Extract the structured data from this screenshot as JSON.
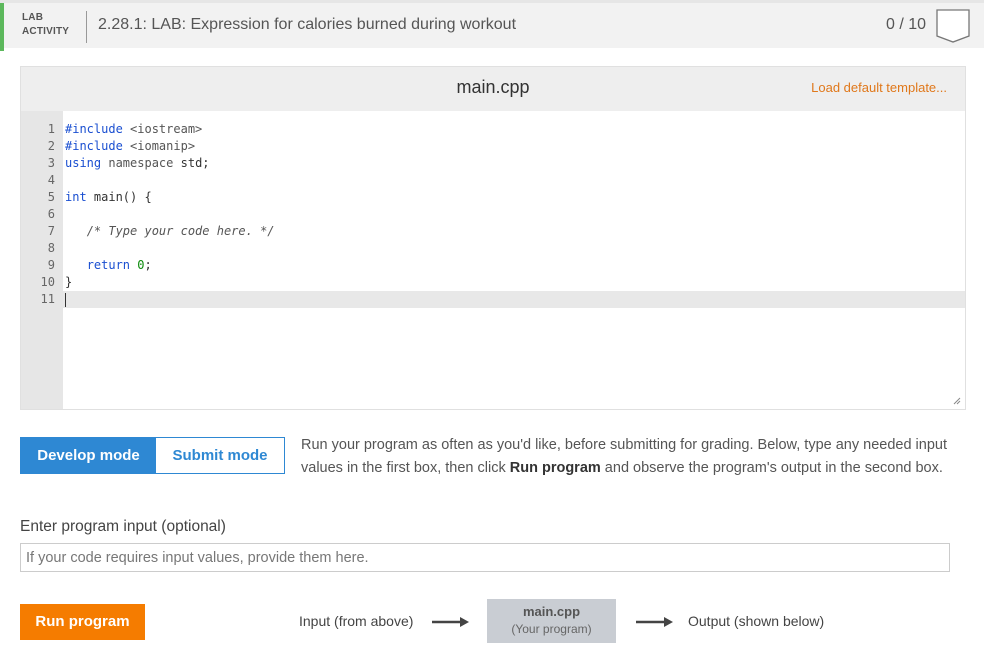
{
  "header": {
    "activity_tag_line1": "LAB",
    "activity_tag_line2": "ACTIVITY",
    "title": "2.28.1: LAB: Expression for calories burned during workout",
    "score": "0 / 10",
    "accent_color": "#5cb85c"
  },
  "editor": {
    "file_name": "main.cpp",
    "load_template_label": "Load default template...",
    "line_numbers": [
      "1",
      "2",
      "3",
      "4",
      "5",
      "6",
      "7",
      "8",
      "9",
      "10",
      "11"
    ],
    "lines": [
      "#include <iostream>",
      "#include <iomanip>",
      "using namespace std;",
      "",
      "int main() {",
      "",
      "   /* Type your code here. */",
      "",
      "   return 0;",
      "}",
      ""
    ]
  },
  "modes": {
    "develop_label": "Develop mode",
    "submit_label": "Submit mode",
    "active": "develop",
    "description_part1": "Run your program as often as you'd like, before submitting for grading. Below, type any needed input values in the first box, then click ",
    "description_bold": "Run program",
    "description_part2": " and observe the program's output in the second box."
  },
  "input": {
    "label": "Enter program input (optional)",
    "placeholder": "If your code requires input values, provide them here.",
    "value": ""
  },
  "run": {
    "button_label": "Run program",
    "flow_input_label": "Input (from above)",
    "program_name": "main.cpp",
    "program_sub": "(Your program)",
    "flow_output_label": "Output (shown below)",
    "button_color": "#f57c00"
  },
  "colors": {
    "primary_blue": "#2e88d3",
    "link_orange": "#e0781b"
  }
}
